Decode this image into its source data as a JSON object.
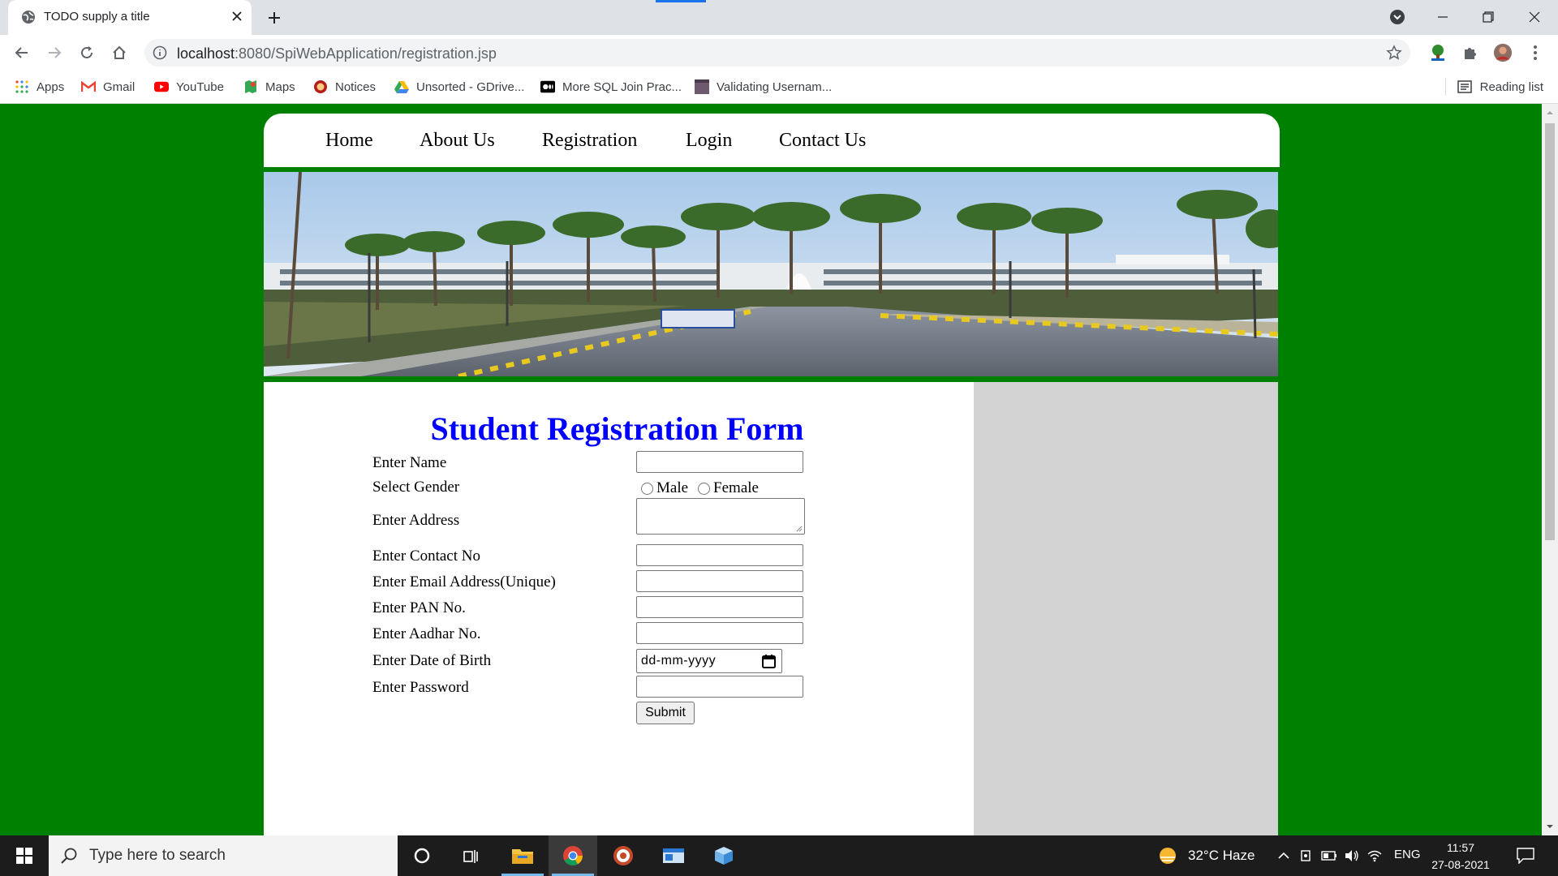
{
  "browser": {
    "tab_title": "TODO supply a title",
    "url_host": "localhost",
    "url_rest": ":8080/SpiWebApplication/registration.jsp",
    "bookmarks": [
      {
        "label": "Apps",
        "icon": "apps-grid-icon"
      },
      {
        "label": "Gmail",
        "icon": "gmail-icon"
      },
      {
        "label": "YouTube",
        "icon": "youtube-icon"
      },
      {
        "label": "Maps",
        "icon": "maps-icon"
      },
      {
        "label": "Notices",
        "icon": "notices-icon"
      },
      {
        "label": "Unsorted - GDrive...",
        "icon": "gdrive-icon"
      },
      {
        "label": "More SQL Join Prac...",
        "icon": "medium-icon"
      },
      {
        "label": "Validating Usernam...",
        "icon": "page-icon"
      }
    ],
    "reading_list": "Reading list"
  },
  "menu": {
    "items": [
      "Home",
      "About Us",
      "Registration",
      "Login",
      "Contact Us"
    ]
  },
  "form": {
    "title": "Student Registration Form",
    "labels": {
      "name": "Enter Name",
      "gender": "Select Gender",
      "address": "Enter Address",
      "contact": "Enter Contact No",
      "email": "Enter Email Address(Unique)",
      "pan": "Enter PAN No.",
      "aadhar": "Enter Aadhar No.",
      "dob": "Enter Date of Birth",
      "password": "Enter Password"
    },
    "gender_options": [
      "Male",
      "Female"
    ],
    "dob_placeholder": "dd-mm-yyyy",
    "submit_label": "Submit"
  },
  "taskbar": {
    "search_placeholder": "Type here to search",
    "weather": "32°C  Haze",
    "language": "ENG",
    "time": "11:57",
    "date": "27-08-2021"
  },
  "colors": {
    "page_background": "#008000",
    "title": "#0000ff",
    "sidebar": "#d3d3d3"
  }
}
